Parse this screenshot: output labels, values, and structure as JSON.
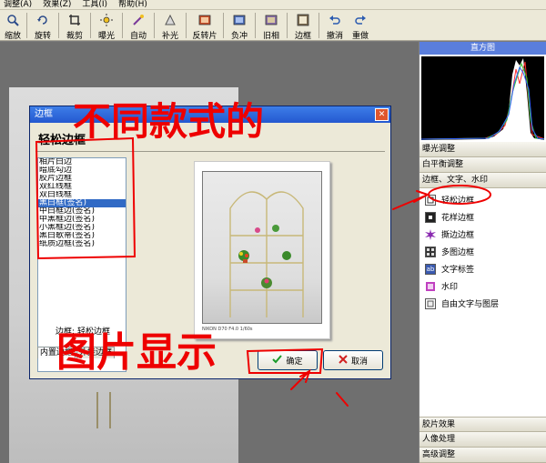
{
  "menu": {
    "items": [
      "调整(A)",
      "效果(Z)",
      "工具(I)",
      "帮助(H)"
    ]
  },
  "toolbar": {
    "buttons": [
      {
        "label": "缩放",
        "icon": "zoom-icon"
      },
      {
        "label": "旋转",
        "icon": "rotate-icon"
      },
      {
        "label": "裁剪",
        "icon": "crop-icon"
      },
      {
        "label": "曝光",
        "icon": "exposure-icon"
      },
      {
        "label": "自动",
        "icon": "auto-icon"
      },
      {
        "label": "补光",
        "icon": "fill-light-icon"
      },
      {
        "label": "反转片",
        "icon": "reversal-film-icon"
      },
      {
        "label": "负冲",
        "icon": "cross-process-icon"
      },
      {
        "label": "旧相",
        "icon": "old-photo-icon"
      },
      {
        "label": "边框",
        "icon": "frame-icon"
      },
      {
        "label": "撤消",
        "icon": "undo-icon"
      },
      {
        "label": "重做",
        "icon": "redo-icon"
      }
    ]
  },
  "right_panel": {
    "histogram_title": "直方图",
    "sections": [
      "曝光调整",
      "白平衡调整",
      "边框、文字、水印"
    ],
    "sub_items": [
      {
        "label": "轻松边框",
        "icon": "easy-frame-icon"
      },
      {
        "label": "花样边框",
        "icon": "pattern-frame-icon"
      },
      {
        "label": "撕边边框",
        "icon": "torn-edge-frame-icon"
      },
      {
        "label": "多图边框",
        "icon": "multi-image-frame-icon"
      },
      {
        "label": "文字标签",
        "icon": "text-label-icon"
      },
      {
        "label": "水印",
        "icon": "watermark-icon"
      },
      {
        "label": "自由文字与图层",
        "icon": "free-text-layer-icon"
      }
    ],
    "bottom_sections": [
      "胶片效果",
      "人像处理",
      "高级调整"
    ]
  },
  "dialog": {
    "title": "边框",
    "header": "轻松边框",
    "list_items": [
      "相片白边",
      "暗底勾边",
      "胶片边框",
      "双红线框",
      "双白线框",
      "黑白框(签名)",
      "中白框边(签名)",
      "中黑框边(签名)",
      "小黑框边(签名)",
      "黑白歌蒂(签名)",
      "纸质边框(签名)"
    ],
    "selected_index": 5,
    "status": "边框: 轻松边框",
    "tabs": [
      "内置边框",
      "外挂边框"
    ],
    "photo_caption": "NIKON D70 F4.0 1/60s",
    "ok_label": "确定",
    "cancel_label": "取消"
  },
  "annotations": {
    "top_text": "不同款式的",
    "bottom_text": "图片显示"
  },
  "colors": {
    "accent": "#2458d0",
    "annotation": "#ee0000",
    "selection": "#316ac5"
  }
}
